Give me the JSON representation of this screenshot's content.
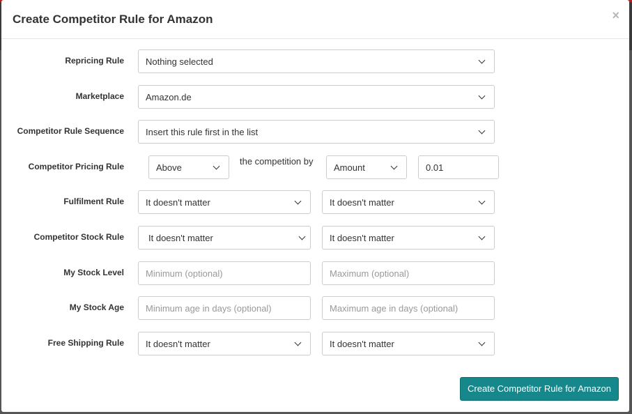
{
  "modal": {
    "title": "Create Competitor Rule for Amazon",
    "close": "×",
    "submit_label": "Create Competitor Rule for Amazon"
  },
  "form": {
    "repricing_rule": {
      "label": "Repricing Rule",
      "value": "Nothing selected"
    },
    "marketplace": {
      "label": "Marketplace",
      "value": "Amazon.de"
    },
    "sequence": {
      "label": "Competitor Rule Sequence",
      "value": "Insert this rule first in the list"
    },
    "pricing": {
      "label": "Competitor Pricing Rule",
      "direction": "Above",
      "middle_text": "the competition by",
      "type": "Amount",
      "amount": "0.01"
    },
    "fulfilment": {
      "label": "Fulfilment Rule",
      "value1": "It doesn't matter",
      "value2": "It doesn't matter"
    },
    "stock_rule": {
      "label": "Competitor Stock Rule",
      "value1": "It doesn't matter",
      "value2": "It doesn't matter"
    },
    "stock_level": {
      "label": "My Stock Level",
      "min_placeholder": "Minimum (optional)",
      "max_placeholder": "Maximum (optional)"
    },
    "stock_age": {
      "label": "My Stock Age",
      "min_placeholder": "Minimum age in days (optional)",
      "max_placeholder": "Maximum age in days (optional)"
    },
    "free_shipping": {
      "label": "Free Shipping Rule",
      "value1": "It doesn't matter",
      "value2": "It doesn't matter"
    }
  },
  "colors": {
    "primary": "#16878a",
    "border": "#cccccc",
    "placeholder": "#999999"
  }
}
